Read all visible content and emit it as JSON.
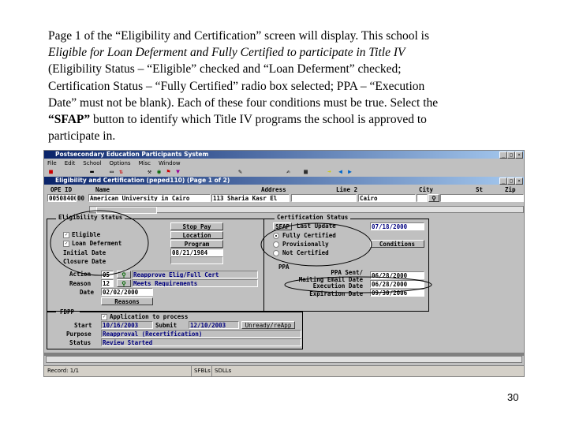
{
  "instructions": {
    "line1": "Page 1 of the “Eligibility and Certification” screen will display.  This school is",
    "line2": "Eligible for Loan Deferment and Fully Certified to participate in Title IV",
    "line3": "(Eligibility Status – “Eligible” checked and “Loan Deferment” checked;",
    "line4": "Certification Status – “Fully Certified” radio box selected; PPA – “Execution",
    "line5": "Date” must not be blank).  Each of these four conditions must be true. Select the",
    "line6_bold": "“SFAP”",
    "line6_rest": " button to identify which Title IV programs the school is approved to",
    "line7": "participate in."
  },
  "app": {
    "title": "Postsecondary Education Participants System",
    "menu": [
      "File",
      "Edit",
      "School",
      "Options",
      "Misc",
      "Window"
    ],
    "window_controls": [
      "_",
      "□",
      "×"
    ]
  },
  "window": {
    "title": "Eligibility and Certification (peped110) (Page 1 of 2)"
  },
  "header": {
    "labels": {
      "id": "OPE ID",
      "name": "Name",
      "address": "Address",
      "line2": "Line 2",
      "city": "City",
      "st": "St",
      "zip": "Zip"
    },
    "values": {
      "id": "00508400",
      "suffix": "00",
      "name": "American University in Cairo",
      "address": "113 Sharia Kasr El",
      "line2": "",
      "city": "Cairo",
      "st": "",
      "zip": ""
    }
  },
  "eligibility": {
    "title": "Eligibility Status",
    "eligible_label": "Eligible",
    "eligible_checked": true,
    "loan_label": "Loan Deferment",
    "loan_checked": true,
    "initial_date_label": "Initial Date",
    "closure_date_label": "Closure Date",
    "buttons": [
      "Stop Pay",
      "Location",
      "Program"
    ],
    "initial_date": "08/21/1984",
    "action_label": "Action",
    "action_code": "05",
    "action_desc": "Reapprove Elig/Full Cert",
    "reason_label": "Reason",
    "reason_code": "12",
    "reason_desc": "Meets Requirements",
    "date_label": "Date",
    "date": "02/02/2000",
    "reasons_button": "Reasons"
  },
  "certification": {
    "title": "Certification Status",
    "sfap_button": "SFAP",
    "last_update_label": "Last Update",
    "last_update": "07/18/2000",
    "options": [
      "Fully Certified",
      "Provisionally",
      "Not Certified"
    ],
    "selected": 0,
    "conditions_button": "Conditions",
    "ppa_label": "PPA",
    "ppa_sent_label": "PPA Sent/",
    "mailing_label": "Mailing Email Date",
    "ppa_sent": "06/28/2000",
    "execution_label": "Execution Date",
    "execution": "06/28/2000",
    "expiration_label": "Expiration Date",
    "expiration": "09/30/2006"
  },
  "fdpp": {
    "title": "FDPP",
    "app_label": "Application to process",
    "app_checked": true,
    "start_label": "Start",
    "start": "10/16/2003",
    "submit_label": "Submit",
    "submit": "12/10/2003",
    "unready_button": "Unready/reApp",
    "purpose_label": "Purpose",
    "purpose": "Reapproval (Recertification)",
    "status_label": "Status",
    "status": "Review Started"
  },
  "statusbar": {
    "record": "Record: 1/1",
    "seg1": "SFBLs",
    "seg2": "SDLLs"
  },
  "page_number": "30"
}
